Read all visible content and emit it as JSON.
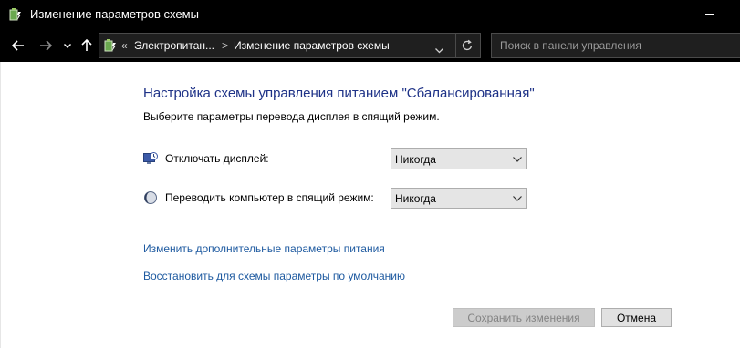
{
  "window": {
    "title": "Изменение параметров схемы"
  },
  "navigation": {
    "back_icon": "arrow-left-icon",
    "forward_icon": "arrow-right-icon",
    "history_icon": "chevron-down-icon",
    "up_icon": "arrow-up-icon",
    "address": {
      "overflow": "«",
      "crumbs": [
        "Электропитан...",
        "Изменение параметров схемы"
      ],
      "separator": ">",
      "refresh_icon": "refresh-icon"
    },
    "search": {
      "placeholder": "Поиск в панели управления"
    }
  },
  "main": {
    "heading": "Настройка схемы управления питанием \"Сбалансированная\"",
    "subtext": "Выберите параметры перевода дисплея в спящий режим.",
    "settings": [
      {
        "label": "Отключать дисплей:",
        "value": "Никогда",
        "icon": "monitor-clock-icon"
      },
      {
        "label": "Переводить компьютер в спящий режим:",
        "value": "Никогда",
        "icon": "moon-icon"
      }
    ],
    "links": [
      "Изменить дополнительные параметры питания",
      "Восстановить для схемы параметры по умолчанию"
    ],
    "buttons": {
      "save": "Сохранить изменения",
      "cancel": "Отмена"
    }
  },
  "colors": {
    "titlebar": "#000000",
    "heading": "#1e3287",
    "link": "#1e5aa0",
    "disabled_text": "#838383"
  }
}
